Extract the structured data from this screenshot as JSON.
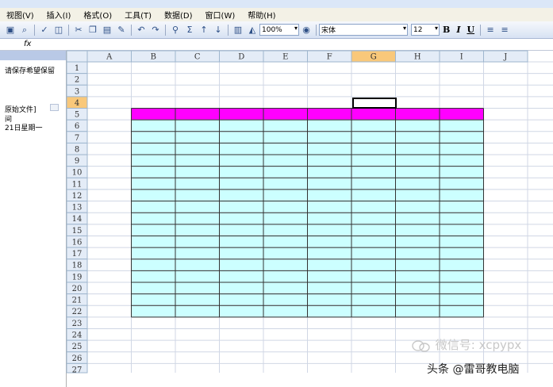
{
  "menu": {
    "items": [
      "视图(V)",
      "插入(I)",
      "格式(O)",
      "工具(T)",
      "数据(D)",
      "窗口(W)",
      "帮助(H)"
    ]
  },
  "toolbar": {
    "zoom": "100%",
    "font_name": "宋体",
    "font_size": "12",
    "bold_label": "B",
    "italic_label": "I",
    "underline_label": "U",
    "sum_label": "Σ"
  },
  "formula_bar": {
    "fx_label": "fx"
  },
  "task_pane": {
    "line1": "请保存希望保留",
    "line2": "原始文件]",
    "line3": "间",
    "line4": "21日星期一"
  },
  "sheet": {
    "columns": [
      "A",
      "B",
      "C",
      "D",
      "E",
      "F",
      "G",
      "H",
      "I",
      "J"
    ],
    "rows": [
      "1",
      "2",
      "3",
      "4",
      "5",
      "6",
      "7",
      "8",
      "9",
      "10",
      "11",
      "12",
      "13",
      "14",
      "15",
      "16",
      "17",
      "18",
      "19",
      "20",
      "21",
      "22",
      "23",
      "24",
      "25",
      "26",
      "27"
    ],
    "active_column": "G",
    "active_row": "4",
    "header_fill": "#ff00ff",
    "body_fill": "#ccffff"
  },
  "watermark": {
    "text": "微信号: xcpypx"
  },
  "caption": {
    "text": "头条 @雷哥教电脑"
  }
}
